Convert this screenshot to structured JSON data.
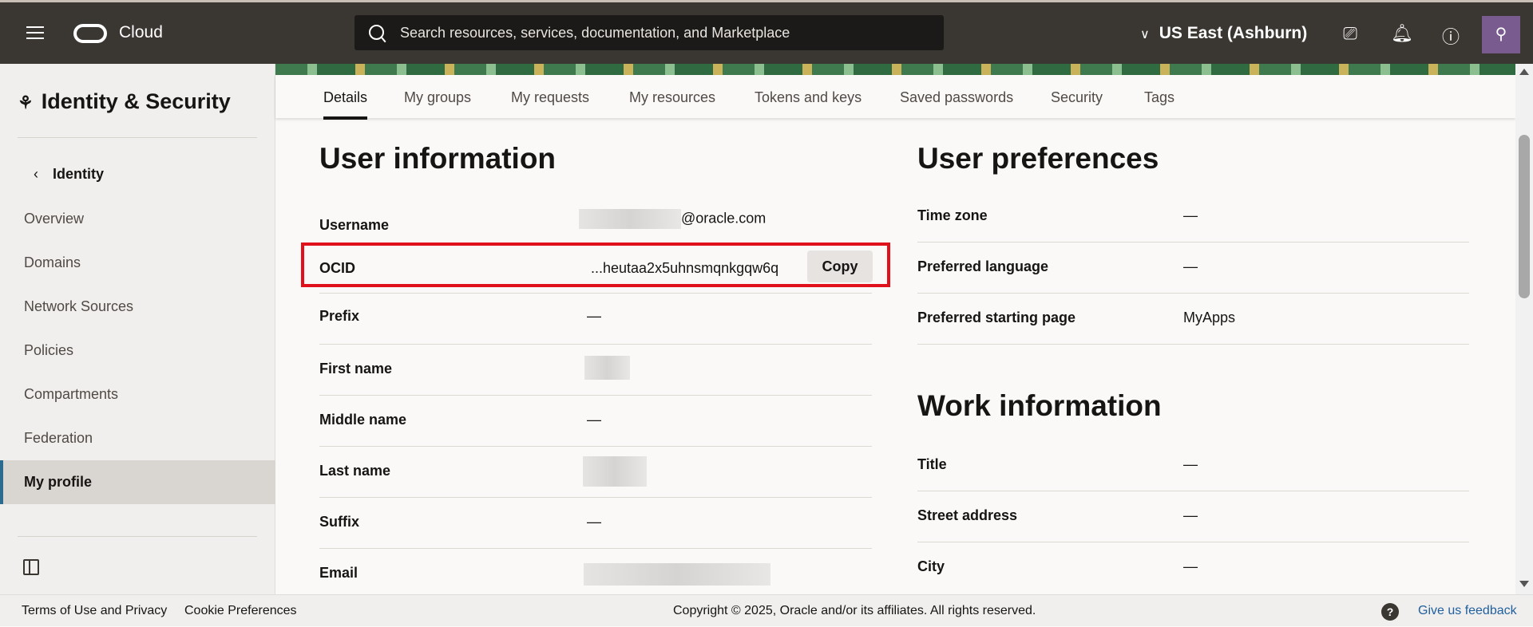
{
  "header": {
    "brand": "Cloud",
    "search_placeholder": "Search resources, services, documentation, and Marketplace",
    "region": "US East (Ashburn)"
  },
  "sidebar": {
    "title": "Identity & Security",
    "back": "Identity",
    "items": [
      "Overview",
      "Domains",
      "Network Sources",
      "Policies",
      "Compartments",
      "Federation",
      "My profile"
    ],
    "active": "My profile"
  },
  "tabs": [
    "Details",
    "My groups",
    "My requests",
    "My resources",
    "Tokens and keys",
    "Saved passwords",
    "Security",
    "Tags"
  ],
  "user_info": {
    "title": "User information",
    "username_label": "Username",
    "username_suffix": "@oracle.com",
    "ocid_label": "OCID",
    "ocid_value": "...heutaa2x5uhnsmqnkgqw6q",
    "copy": "Copy",
    "prefix_label": "Prefix",
    "prefix": "—",
    "first_label": "First name",
    "middle_label": "Middle name",
    "middle": "—",
    "last_label": "Last name",
    "suffix_label": "Suffix",
    "suffix": "—",
    "email_label": "Email"
  },
  "prefs": {
    "title": "User preferences",
    "tz_label": "Time zone",
    "tz": "—",
    "lang_label": "Preferred language",
    "lang": "—",
    "start_label": "Preferred starting page",
    "start": "MyApps"
  },
  "work": {
    "title": "Work information",
    "title_label": "Title",
    "title_val": "—",
    "street_label": "Street address",
    "street": "—",
    "city_label": "City",
    "city": "—"
  },
  "footer": {
    "terms": "Terms of Use and Privacy",
    "cookies": "Cookie Preferences",
    "copyright": "Copyright © 2025, Oracle and/or its affiliates. All rights reserved.",
    "feedback": "Give us feedback",
    "help": "?"
  }
}
